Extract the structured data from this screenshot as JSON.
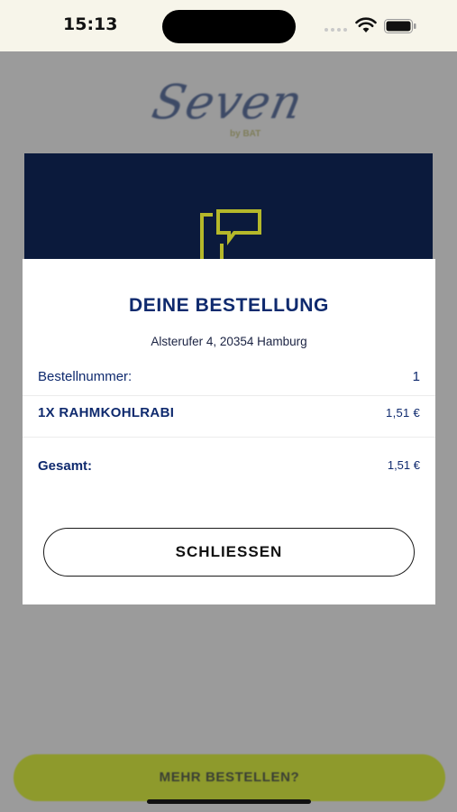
{
  "status_bar": {
    "time": "15:13"
  },
  "background": {
    "logo_text": "Seven",
    "logo_subtext": "by BAT",
    "more_button_label": "MEHR BESTELLEN?"
  },
  "modal": {
    "title": "DEINE BESTELLUNG",
    "address": "Alsterufer 4, 20354 Hamburg",
    "order_number_label": "Bestellnummer:",
    "order_number_value": "1",
    "item_label": "1X RAHMKOHLRABI",
    "item_price": "1,51 €",
    "total_label": "Gesamt:",
    "total_value": "1,51 €",
    "close_button_label": "SCHLIESSEN"
  },
  "colors": {
    "navy": "#0f2a6e",
    "hero_background": "#0b1a3c",
    "accent_lime": "#8e9a2c",
    "overlay_gray": "#9b9b9b"
  }
}
